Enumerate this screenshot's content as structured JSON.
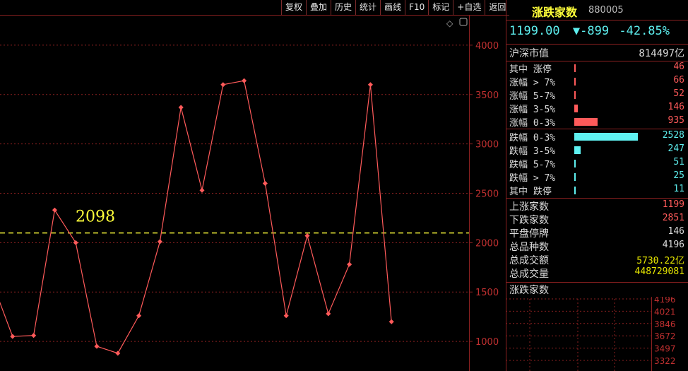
{
  "toolbar": [
    "复权",
    "叠加",
    "历史",
    "统计",
    "画线",
    "F10",
    "标记",
    "+自选",
    "返回"
  ],
  "corner_icons": [
    "diamond-icon",
    "window-icon"
  ],
  "colors": {
    "up": "#ff5a5a",
    "down": "#5ef0f0",
    "grid": "#8a2020",
    "ref": "#ffff3a",
    "name": "#ffff3a"
  },
  "panel": {
    "name": "涨跌家数",
    "code": "880005",
    "price": "1199.00",
    "arrow": "▼",
    "change": "-899",
    "pct": "-42.85%",
    "market_cap_label": "沪深市值",
    "market_cap_value": "814497亿",
    "up_rows": [
      {
        "label": "其中 涨停",
        "value": "46"
      },
      {
        "label": "涨幅 > 7%",
        "value": "66"
      },
      {
        "label": "涨幅 5-7%",
        "value": "52"
      },
      {
        "label": "涨幅 3-5%",
        "value": "146"
      },
      {
        "label": "涨幅 0-3%",
        "value": "935"
      }
    ],
    "down_rows": [
      {
        "label": "跌幅 0-3%",
        "value": "2528"
      },
      {
        "label": "跌幅 3-5%",
        "value": "247"
      },
      {
        "label": "跌幅 5-7%",
        "value": "51"
      },
      {
        "label": "跌幅 > 7%",
        "value": "25"
      },
      {
        "label": "其中 跌停",
        "value": "11"
      }
    ],
    "summary_rows": [
      {
        "label": "上涨家数",
        "value": "1199"
      },
      {
        "label": "下跌家数",
        "value": "2851"
      },
      {
        "label": "平盘停牌",
        "value": "146"
      },
      {
        "label": "总品种数",
        "value": "4196"
      },
      {
        "label": "总成交额",
        "value": "5730.22亿"
      },
      {
        "label": "总成交量",
        "value": "448729081"
      }
    ],
    "mini_title": "涨跌家数",
    "mini_axis": [
      "4196",
      "4021",
      "3846",
      "3672",
      "3497",
      "3322"
    ]
  },
  "chart_data": {
    "type": "line",
    "ylim": [
      700,
      4300
    ],
    "yticks": [
      1000,
      1500,
      2000,
      2500,
      3000,
      3500,
      4000
    ],
    "reference_line": {
      "value": 2098,
      "label": "2098"
    },
    "values": [
      1620,
      1050,
      1060,
      2330,
      2000,
      950,
      880,
      1260,
      2010,
      3370,
      2530,
      3600,
      3640,
      2600,
      1260,
      2070,
      1280,
      1780,
      3600,
      1199
    ]
  }
}
